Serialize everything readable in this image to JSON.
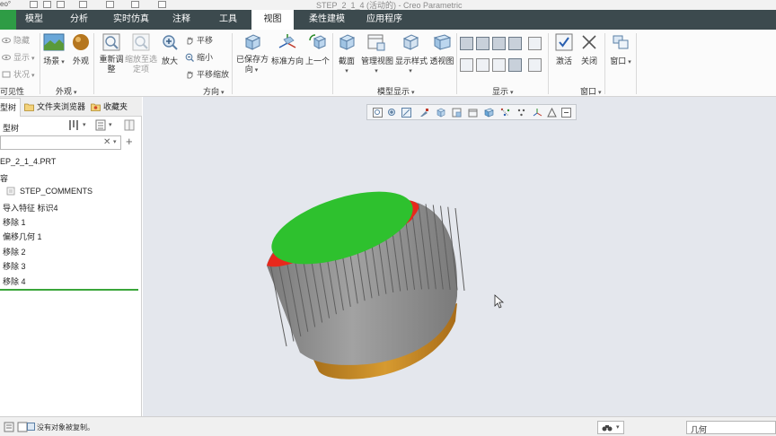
{
  "titlebar": {
    "logo": "eo°",
    "title": "STEP_2_1_4 (活动的) - Creo Parametric"
  },
  "tabs": [
    {
      "label": "模型"
    },
    {
      "label": "分析"
    },
    {
      "label": "实时仿真"
    },
    {
      "label": "注释"
    },
    {
      "label": "工具"
    },
    {
      "label": "视图",
      "active": true
    },
    {
      "label": "柔性建模"
    },
    {
      "label": "应用程序"
    }
  ],
  "ribbon": {
    "visibility": {
      "hide": "隐藏",
      "show": "显示",
      "status": "状况",
      "label": "可见性"
    },
    "appearance": {
      "scene": "场景",
      "appearance": "外观",
      "label": "外观"
    },
    "orientation": {
      "refit_line1": "重新调",
      "refit_line2": "整",
      "zoom_to_selected_line1": "缩放至选",
      "zoom_to_selected_line2": "定项",
      "zoom_in": "放大",
      "pan": "平移",
      "zoom_out": "缩小",
      "pan_zoom": "平移缩放",
      "label": "方向"
    },
    "saved_orient": {
      "saved_line1": "已保存方",
      "saved_line2": "向",
      "standard": "标准方向",
      "previous": "上一个"
    },
    "model_display": {
      "section": "截面",
      "manage_views": "管理视图",
      "display_style": "显示样式",
      "perspective": "透视图",
      "label": "模型显示"
    },
    "show": {
      "label": "显示"
    },
    "window": {
      "activate": "激活",
      "close": "关闭",
      "windows": "窗口",
      "label": "窗口"
    }
  },
  "left_panel": {
    "tabs": {
      "model_tree": "型树",
      "folder_browser": "文件夹浏览器",
      "favorites": "收藏夹"
    },
    "toolbar_title": "型树",
    "search_placeholder": "",
    "items": [
      "EP_2_1_4.PRT",
      "容",
      "STEP_COMMENTS",
      "导入特征 标识4",
      "移除 1",
      "偏移几何 1",
      "移除 2",
      "移除 3",
      "移除 4"
    ]
  },
  "statusbar": {
    "message": "没有对象被复制。",
    "filter": "几何"
  },
  "colors": {
    "ribbon_dark": "#3c4a4e",
    "file_green": "#2e9c45",
    "viewport_bg": "#e4e7ed",
    "model_top": "#2ec12e",
    "model_red": "#e8281c",
    "model_knurl": "#8e8e8e",
    "model_base": "#c98a22"
  }
}
